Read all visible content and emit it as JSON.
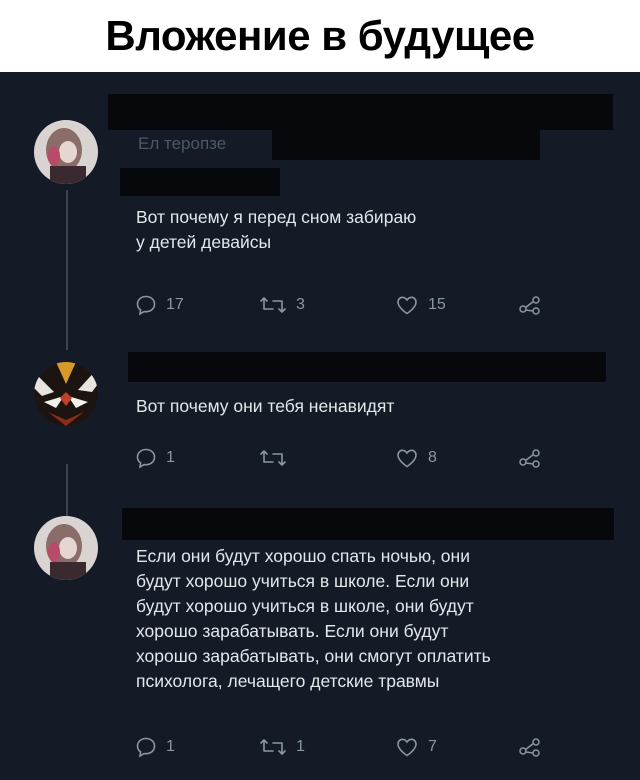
{
  "page": {
    "title": "Вложение в будущее"
  },
  "tweets": [
    {
      "author_fragment": "Ел теропзе",
      "text": "Вот почему я перед сном забираю\nу детей девайсы",
      "replies": "17",
      "retweets": "3",
      "likes": "15"
    },
    {
      "text": "Вот почему они тебя ненавидят",
      "replies": "1",
      "retweets": "",
      "likes": "8"
    },
    {
      "text": "Если они будут хорошо спать ночью, они\nбудут хорошо учиться в школе. Если они\nбудут хорошо учиться в школе, они будут\nхорошо зарабатывать. Если они будут\nхорошо зарабатывать, они смогут оплатить\nпсихолога, лечащего детские травмы",
      "replies": "1",
      "retweets": "1",
      "likes": "7"
    }
  ],
  "colors": {
    "background": "#141b26",
    "text": "#e3e7ec",
    "icon": "#8a96a4",
    "redaction": "#06080c"
  },
  "icons": {
    "reply": "speech-bubble-icon",
    "retweet": "retweet-arrows-icon",
    "like": "heart-icon",
    "share": "share-nodes-icon"
  }
}
